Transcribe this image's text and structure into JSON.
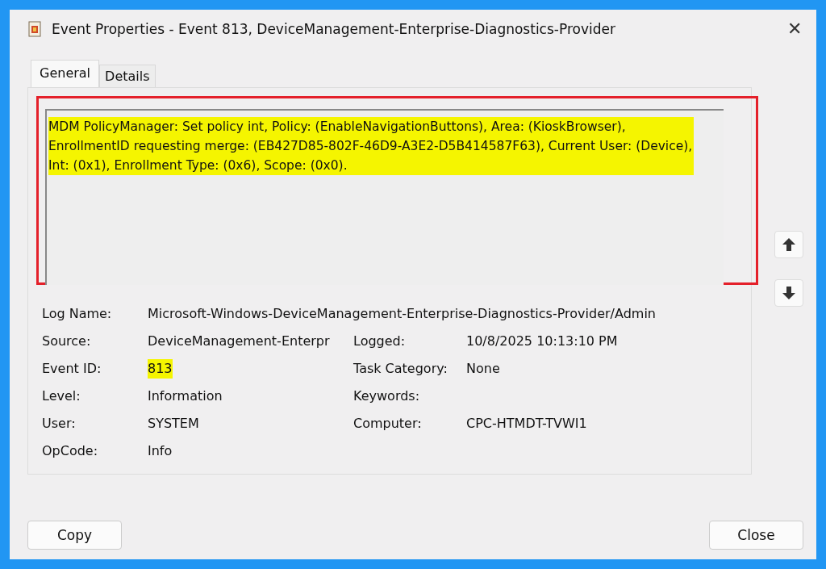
{
  "window": {
    "title": "Event Properties - Event 813, DeviceManagement-Enterprise-Diagnostics-Provider",
    "close": "✕"
  },
  "tabs": [
    {
      "label": "General",
      "selected": true
    },
    {
      "label": "Details",
      "selected": false
    }
  ],
  "description": {
    "text": "MDM PolicyManager: Set policy int, Policy: (EnableNavigationButtons), Area: (KioskBrowser), EnrollmentID requesting merge: (EB427D85-802F-46D9-A3E2-D5B414587F63), Current User: (Device), Int: (0x1), Enrollment Type: (0x6), Scope: (0x0).",
    "highlighted": true
  },
  "field_rows": [
    [
      {
        "label": "Log Name:",
        "value": "Microsoft-Windows-DeviceManagement-Enterprise-Diagnostics-Provider/Admin"
      }
    ],
    [
      {
        "label": "Source:",
        "value": "DeviceManagement-Enterpr"
      },
      {
        "label": "Logged:",
        "value": "10/8/2025 10:13:10 PM"
      }
    ],
    [
      {
        "label": "Event ID:",
        "value": "813",
        "highlighted": true
      },
      {
        "label": "Task Category:",
        "value": "None"
      }
    ],
    [
      {
        "label": "Level:",
        "value": "Information"
      },
      {
        "label": "Keywords:"
      }
    ],
    [
      {
        "label": "User:",
        "value": "SYSTEM"
      },
      {
        "label": "Computer:",
        "value": "CPC-HTMDT-TVWI1"
      }
    ],
    [
      {
        "label": "OpCode:",
        "value": "Info"
      }
    ]
  ],
  "buttons": [
    {
      "label": "Copy"
    },
    {
      "label": "Close"
    }
  ]
}
